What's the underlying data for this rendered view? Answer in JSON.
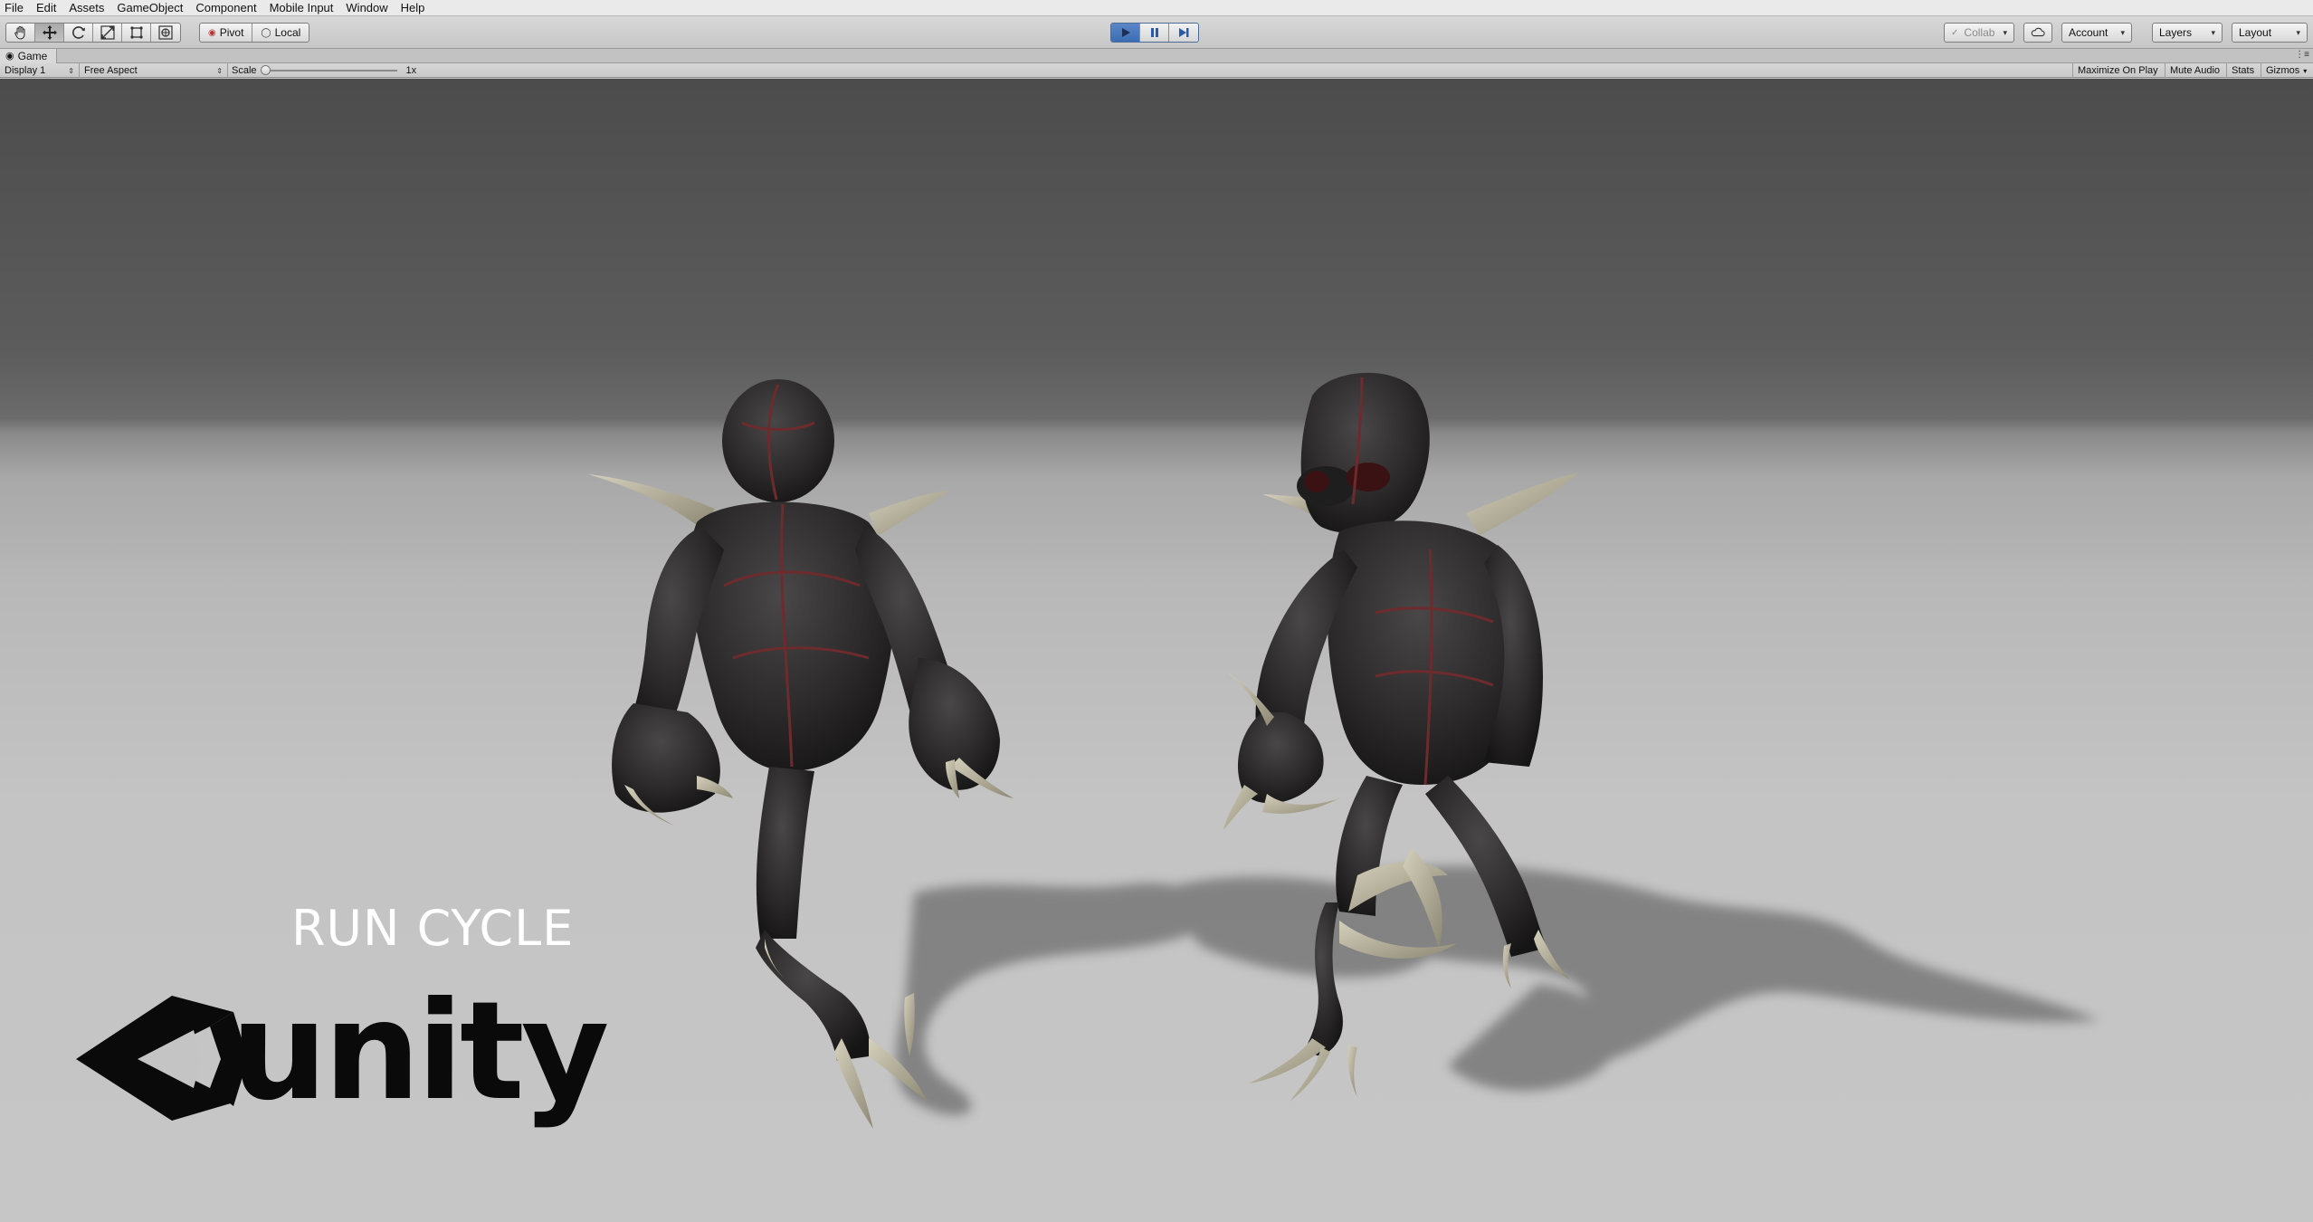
{
  "menu": {
    "items": [
      "File",
      "Edit",
      "Assets",
      "GameObject",
      "Component",
      "Mobile Input",
      "Window",
      "Help"
    ]
  },
  "toolbar": {
    "tools": [
      "hand-icon",
      "move-icon",
      "rotate-icon",
      "scale-icon",
      "rect-icon",
      "transform-icon"
    ],
    "pivot_label": "Pivot",
    "local_label": "Local",
    "play_controls": [
      "play-icon",
      "pause-icon",
      "step-icon"
    ],
    "collab_label": "Collab",
    "account_label": "Account",
    "layers_label": "Layers",
    "layout_label": "Layout"
  },
  "game_tab": {
    "title": "Game"
  },
  "game_bar": {
    "display_label": "Display 1",
    "aspect_label": "Free Aspect",
    "scale_label": "Scale",
    "scale_value": "1x",
    "maximize_label": "Maximize On Play",
    "mute_label": "Mute Audio",
    "stats_label": "Stats",
    "gizmos_label": "Gizmos"
  },
  "viewport": {
    "caption": "RUN CYCLE",
    "logo_text": "unity"
  },
  "colors": {
    "play_active": "#3b6db3",
    "creature_body": "#2b2a2b",
    "creature_seam": "#6e2b2d",
    "claw": "#b7b29c"
  }
}
